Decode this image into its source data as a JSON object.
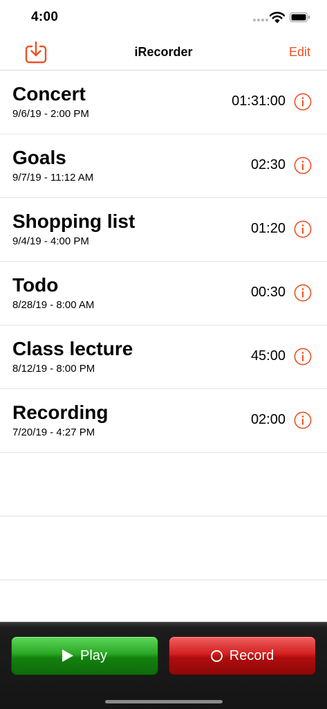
{
  "status_bar": {
    "time": "4:00"
  },
  "nav": {
    "title": "iRecorder",
    "edit_label": "Edit",
    "import_icon": "tray-download-icon"
  },
  "colors": {
    "accent": "#f05023",
    "play_green": "#1f9a1a",
    "record_red": "#c41515",
    "toolbar_dark": "#151515"
  },
  "recordings": [
    {
      "title": "Concert",
      "date": "9/6/19 - 2:00 PM",
      "duration": "01:31:00"
    },
    {
      "title": "Goals",
      "date": "9/7/19 - 11:12 AM",
      "duration": "02:30"
    },
    {
      "title": "Shopping list",
      "date": "9/4/19 - 4:00 PM",
      "duration": "01:20"
    },
    {
      "title": "Todo",
      "date": "8/28/19 - 8:00 AM",
      "duration": "00:30"
    },
    {
      "title": "Class lecture",
      "date": "8/12/19 - 8:00 PM",
      "duration": "45:00"
    },
    {
      "title": "Recording",
      "date": "7/20/19 - 4:27 PM",
      "duration": "02:00"
    }
  ],
  "toolbar": {
    "play_label": "Play",
    "record_label": "Record"
  }
}
